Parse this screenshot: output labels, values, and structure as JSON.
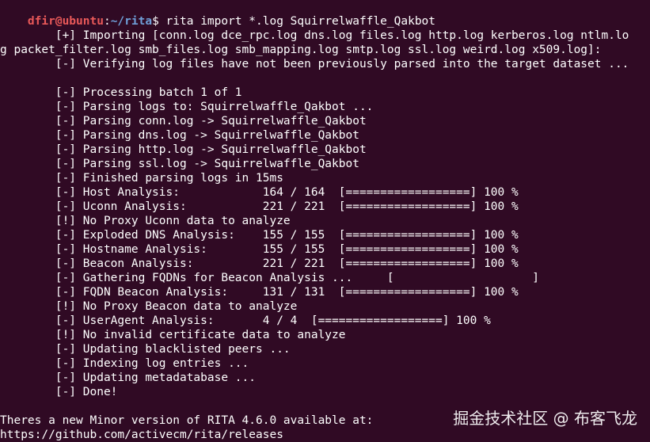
{
  "prompt": {
    "user_host": "dfir@ubuntu",
    "path": "~/rita",
    "symbol": "$",
    "command": " rita import *.log Squirrelwaffle_Qakbot"
  },
  "output_lines": [
    "",
    "        [+] Importing [conn.log dce_rpc.log dns.log files.log http.log kerberos.log ntlm.lo",
    "g packet_filter.log smb_files.log smb_mapping.log smtp.log ssl.log weird.log x509.log]:",
    "        [-] Verifying log files have not been previously parsed into the target dataset ...",
    "",
    "        [-] Processing batch 1 of 1",
    "        [-] Parsing logs to: Squirrelwaffle_Qakbot ...",
    "        [-] Parsing conn.log -> Squirrelwaffle_Qakbot",
    "        [-] Parsing dns.log -> Squirrelwaffle_Qakbot",
    "        [-] Parsing http.log -> Squirrelwaffle_Qakbot",
    "        [-] Parsing ssl.log -> Squirrelwaffle_Qakbot",
    "        [-] Finished parsing logs in 15ms",
    "        [-] Host Analysis:            164 / 164  [==================] 100 %",
    "        [-] Uconn Analysis:           221 / 221  [==================] 100 %",
    "        [!] No Proxy Uconn data to analyze",
    "        [-] Exploded DNS Analysis:    155 / 155  [==================] 100 %",
    "        [-] Hostname Analysis:        155 / 155  [==================] 100 %",
    "        [-] Beacon Analysis:          221 / 221  [==================] 100 %",
    "        [-] Gathering FQDNs for Beacon Analysis ...     [                    ]",
    "        [-] FQDN Beacon Analysis:     131 / 131  [==================] 100 %",
    "        [!] No Proxy Beacon data to analyze",
    "        [-] UserAgent Analysis:       4 / 4  [==================] 100 %",
    "        [!] No invalid certificate data to analyze",
    "        [-] Updating blacklisted peers ...",
    "        [-] Indexing log entries ...",
    "        [-] Updating metadatabase ...",
    "        [-] Done!",
    "",
    "Theres a new Minor version of RITA 4.6.0 available at:",
    "https://github.com/activecm/rita/releases"
  ],
  "watermark": "掘金技术社区 @ 布客飞龙",
  "colors": {
    "background": "#300a24",
    "text": "#ffffff",
    "prompt_user": "#e95959",
    "prompt_path": "#6f9fd8"
  }
}
